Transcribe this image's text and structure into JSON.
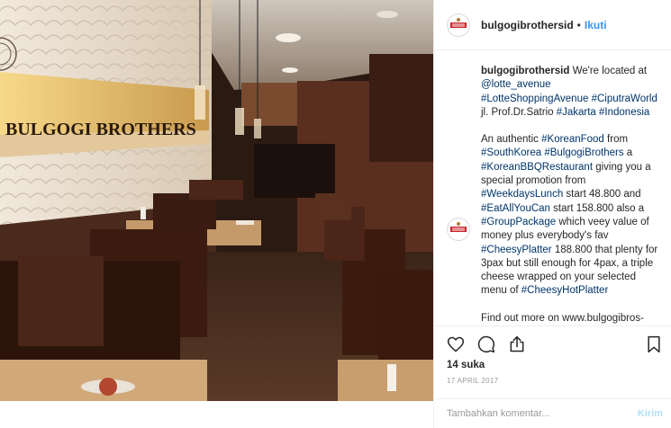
{
  "post": {
    "photo_sign_text": "BULGOGI BROTHERS",
    "username": "bulgogibrothersid",
    "dot": "•",
    "follow_label": "Ikuti",
    "caption_paragraphs": [
      [
        {
          "t": "user",
          "v": "bulgogibrothersid"
        },
        {
          "t": "text",
          "v": " We're located at "
        },
        {
          "t": "link",
          "v": "@lotte_avenue"
        },
        {
          "t": "text",
          "v": " "
        },
        {
          "t": "link",
          "v": "#LotteShoppingAvenue"
        },
        {
          "t": "text",
          "v": " "
        },
        {
          "t": "link",
          "v": "#CiputraWorld"
        },
        {
          "t": "text",
          "v": " jl. Prof.Dr.Satrio "
        },
        {
          "t": "link",
          "v": "#Jakarta"
        },
        {
          "t": "text",
          "v": " "
        },
        {
          "t": "link",
          "v": "#Indonesia"
        }
      ],
      [
        {
          "t": "text",
          "v": "An authentic "
        },
        {
          "t": "link",
          "v": "#KoreanFood"
        },
        {
          "t": "text",
          "v": " from "
        },
        {
          "t": "link",
          "v": "#SouthKorea"
        },
        {
          "t": "text",
          "v": " "
        },
        {
          "t": "link",
          "v": "#BulgogiBrothers"
        },
        {
          "t": "text",
          "v": " a "
        },
        {
          "t": "link",
          "v": "#KoreanBBQRestaurant"
        },
        {
          "t": "text",
          "v": " giving you a special promotion from "
        },
        {
          "t": "link",
          "v": "#WeekdaysLunch"
        },
        {
          "t": "text",
          "v": " start 48.800 and "
        },
        {
          "t": "link",
          "v": "#EatAllYouCan"
        },
        {
          "t": "text",
          "v": " start 158.800 also a "
        },
        {
          "t": "link",
          "v": "#GroupPackage"
        },
        {
          "t": "text",
          "v": " which veey value of money plus everybody's fav "
        },
        {
          "t": "link",
          "v": "#CheesyPlatter"
        },
        {
          "t": "text",
          "v": " 188.800 that plenty for 3pax but still enough for 4pax, a triple cheese wrapped on your selected menu of "
        },
        {
          "t": "link",
          "v": "#CheesyHotPlatter"
        }
      ],
      [
        {
          "t": "text",
          "v": "Find out more on www.bulgogibros-"
        }
      ]
    ],
    "likes": "14 suka",
    "date": "17 APRIL 2017",
    "comment_placeholder": "Tambahkan komentar...",
    "post_label": "Kirim"
  },
  "icons": {
    "like": "heart-icon",
    "comment": "comment-icon",
    "share": "share-icon",
    "save": "bookmark-icon"
  }
}
